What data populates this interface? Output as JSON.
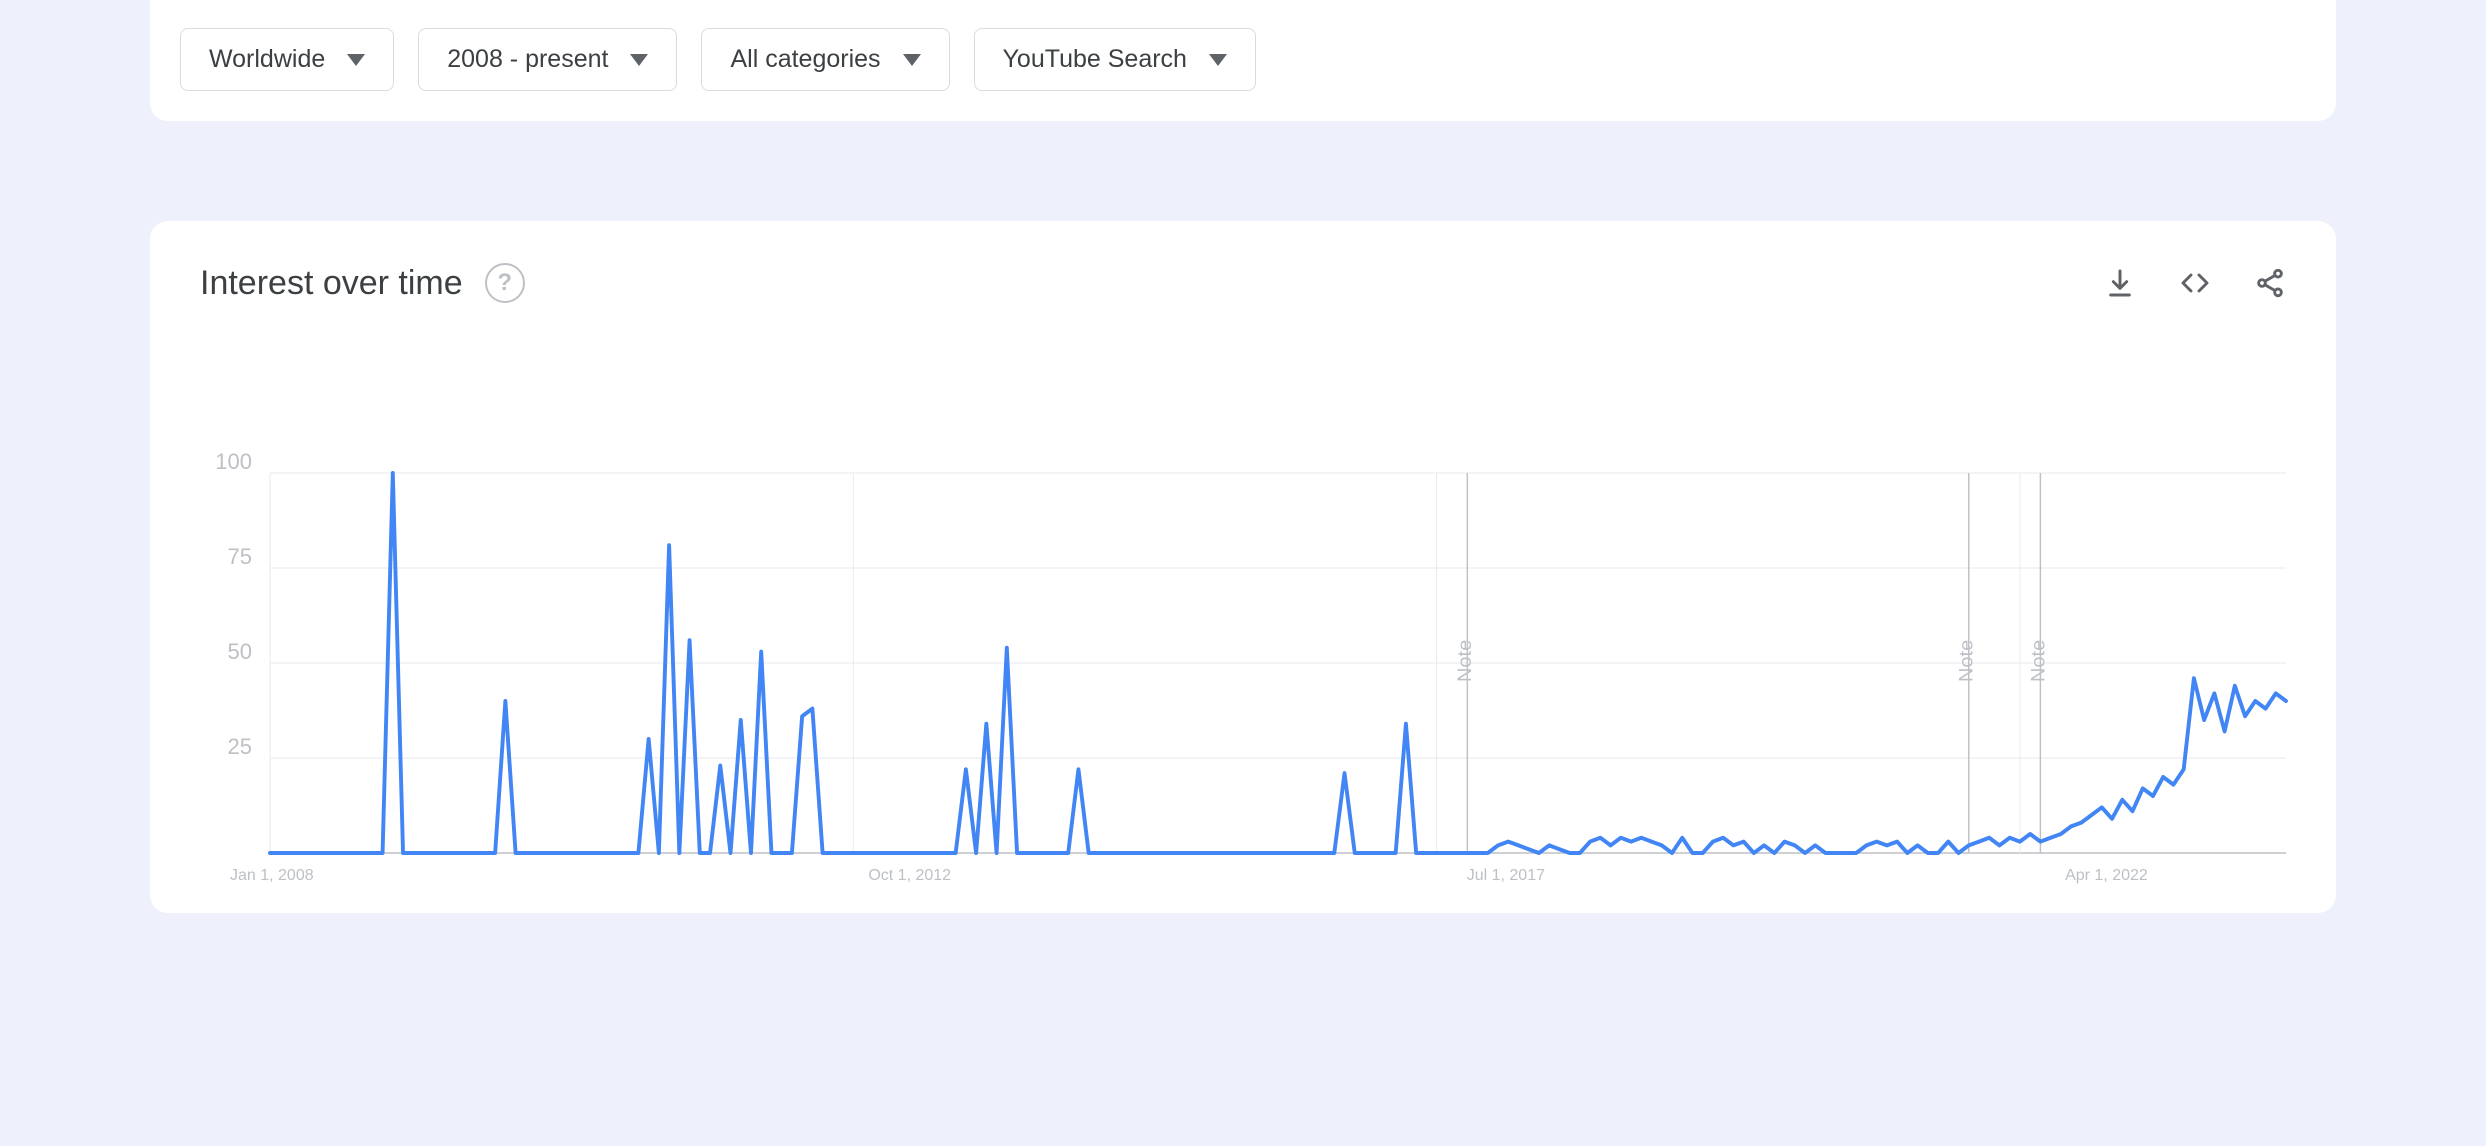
{
  "filters": {
    "region": "Worldwide",
    "time": "2008 - present",
    "category": "All categories",
    "search_type": "YouTube Search"
  },
  "panel": {
    "title": "Interest over time"
  },
  "chart_data": {
    "type": "line",
    "title": "Interest over time",
    "ylabel": "",
    "xlabel": "",
    "ylim": [
      0,
      100
    ],
    "y_ticks": [
      25,
      50,
      75,
      100
    ],
    "x_tick_labels": [
      "Jan 1, 2008",
      "Oct 1, 2012",
      "Jul 1, 2017",
      "Apr 1, 2022"
    ],
    "x_tick_positions": [
      0,
      57,
      114,
      171
    ],
    "notes_at_index": [
      117,
      166,
      173
    ],
    "note_label": "Note",
    "x_index_range": [
      0,
      197
    ],
    "series": [
      {
        "name": "interest",
        "values": [
          0,
          0,
          0,
          0,
          0,
          0,
          0,
          0,
          0,
          0,
          0,
          0,
          100,
          0,
          0,
          0,
          0,
          0,
          0,
          0,
          0,
          0,
          0,
          40,
          0,
          0,
          0,
          0,
          0,
          0,
          0,
          0,
          0,
          0,
          0,
          0,
          0,
          30,
          0,
          81,
          0,
          56,
          0,
          0,
          23,
          0,
          35,
          0,
          53,
          0,
          0,
          0,
          36,
          38,
          0,
          0,
          0,
          0,
          0,
          0,
          0,
          0,
          0,
          0,
          0,
          0,
          0,
          0,
          22,
          0,
          34,
          0,
          54,
          0,
          0,
          0,
          0,
          0,
          0,
          22,
          0,
          0,
          0,
          0,
          0,
          0,
          0,
          0,
          0,
          0,
          0,
          0,
          0,
          0,
          0,
          0,
          0,
          0,
          0,
          0,
          0,
          0,
          0,
          0,
          0,
          21,
          0,
          0,
          0,
          0,
          0,
          34,
          0,
          0,
          0,
          0,
          0,
          0,
          0,
          0,
          2,
          3,
          2,
          1,
          0,
          2,
          1,
          0,
          0,
          3,
          4,
          2,
          4,
          3,
          4,
          3,
          2,
          0,
          4,
          0,
          0,
          3,
          4,
          2,
          3,
          0,
          2,
          0,
          3,
          2,
          0,
          2,
          0,
          0,
          0,
          0,
          2,
          3,
          2,
          3,
          0,
          2,
          0,
          0,
          3,
          0,
          2,
          3,
          4,
          2,
          4,
          3,
          5,
          3,
          4,
          5,
          7,
          8,
          10,
          12,
          9,
          14,
          11,
          17,
          15,
          20,
          18,
          22,
          46,
          35,
          42,
          32,
          44,
          36,
          40,
          38,
          42,
          40
        ]
      }
    ]
  }
}
